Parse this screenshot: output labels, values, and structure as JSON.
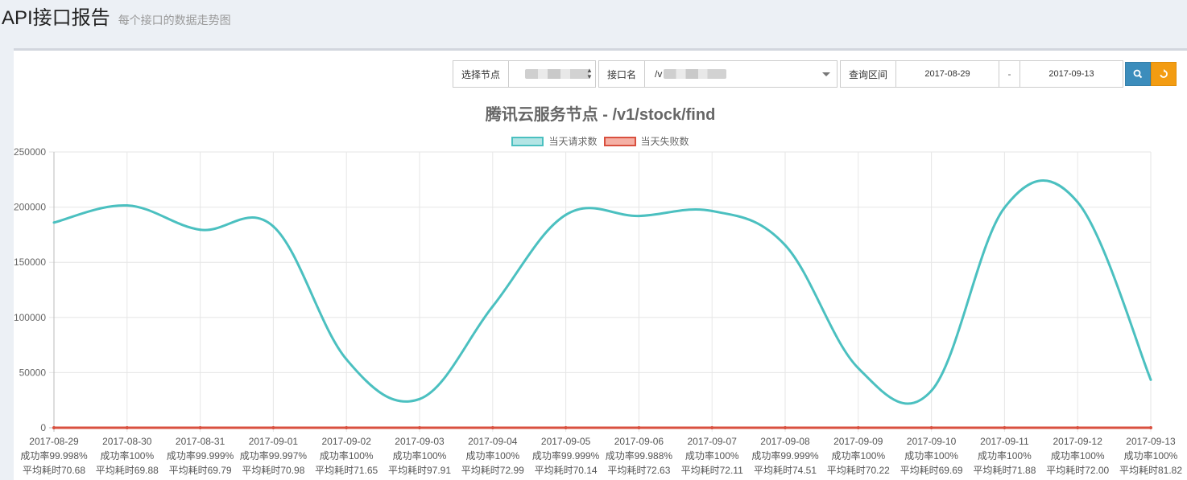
{
  "header": {
    "title": "API接口报告",
    "subtitle": "每个接口的数据走势图"
  },
  "filters": {
    "node_label": "选择节点",
    "api_label": "接口名",
    "api_value_prefix": "/v",
    "range_label": "查询区间",
    "date_from": "2017-08-29",
    "date_separator": "-",
    "date_to": "2017-09-13",
    "search_icon": "search-icon",
    "reset_icon": "refresh-icon"
  },
  "chart_data": {
    "type": "line",
    "title": "腾讯云服务节点 - /v1/stock/find",
    "ylim": [
      0,
      250000
    ],
    "yticks": [
      0,
      50000,
      100000,
      150000,
      200000,
      250000
    ],
    "grid": true,
    "legend_position": "top-center",
    "categories": [
      "2017-08-29",
      "2017-08-30",
      "2017-08-31",
      "2017-09-01",
      "2017-09-02",
      "2017-09-03",
      "2017-09-04",
      "2017-09-05",
      "2017-09-06",
      "2017-09-07",
      "2017-09-08",
      "2017-09-09",
      "2017-09-10",
      "2017-09-11",
      "2017-09-12",
      "2017-09-13"
    ],
    "success_rates": [
      "成功率99.998%",
      "成功率100%",
      "成功率99.999%",
      "成功率99.997%",
      "成功率100%",
      "成功率100%",
      "成功率100%",
      "成功率99.999%",
      "成功率99.988%",
      "成功率100%",
      "成功率99.999%",
      "成功率100%",
      "成功率100%",
      "成功率100%",
      "成功率100%",
      "成功率100%"
    ],
    "avg_times": [
      "平均耗时70.68",
      "平均耗时69.88",
      "平均耗时69.79",
      "平均耗时70.98",
      "平均耗时71.65",
      "平均耗时97.91",
      "平均耗时72.99",
      "平均耗时70.14",
      "平均耗时72.63",
      "平均耗时72.11",
      "平均耗时74.51",
      "平均耗时70.22",
      "平均耗时69.69",
      "平均耗时71.88",
      "平均耗时72.00",
      "平均耗时81.82"
    ],
    "series": [
      {
        "name": "当天请求数",
        "color": "#4bc0c0",
        "fill": "#b3e5e5",
        "values": [
          186000,
          201500,
          179500,
          182500,
          62000,
          26000,
          110000,
          193000,
          192000,
          196500,
          165500,
          54000,
          33500,
          199500,
          204500,
          43500
        ]
      },
      {
        "name": "当天失败数",
        "color": "#d9503f",
        "fill": "#f5b0a5",
        "values": [
          3,
          0,
          2,
          5,
          0,
          0,
          0,
          2,
          22,
          0,
          2,
          0,
          0,
          0,
          0,
          0
        ]
      }
    ]
  }
}
